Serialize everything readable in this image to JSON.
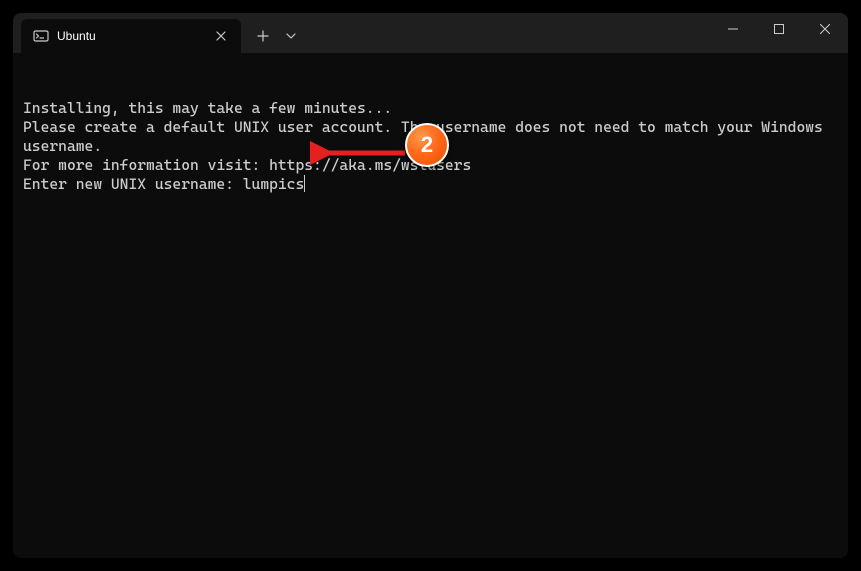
{
  "tab": {
    "title": "Ubuntu"
  },
  "terminal": {
    "line1": "Installing, this may take a few minutes...",
    "line2": "Please create a default UNIX user account. The username does not need to match your Windows username.",
    "line3": "For more information visit: https://aka.ms/wslusers",
    "prompt": "Enter new UNIX username: ",
    "input_value": "lumpics"
  },
  "annotation": {
    "badge_number": "2"
  }
}
